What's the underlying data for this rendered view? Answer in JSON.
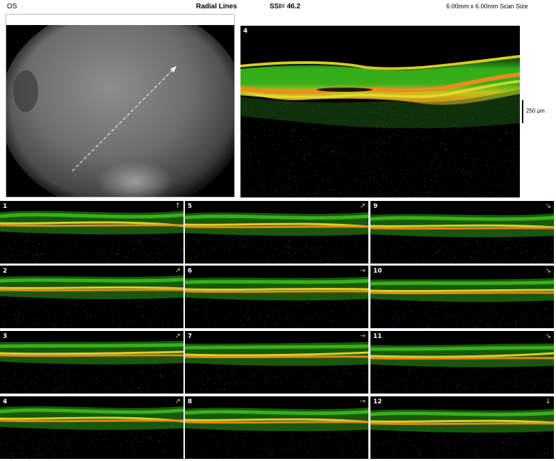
{
  "header": {
    "eye": "OS",
    "scan_pattern": "Radial Lines",
    "ssi": "SSI= 46.2",
    "scan_size": "6.00mm x 6.00mm Scan Size"
  },
  "fundus": {
    "scan_line_icon": "arrow-icon"
  },
  "main_scan": {
    "number": "4",
    "scale_label": "250 µm"
  },
  "thumbnails": [
    {
      "number": "1",
      "arrow": "↑"
    },
    {
      "number": "5",
      "arrow": "↗"
    },
    {
      "number": "9",
      "arrow": "↘"
    },
    {
      "number": "2",
      "arrow": "↗"
    },
    {
      "number": "6",
      "arrow": "→"
    },
    {
      "number": "10",
      "arrow": "↘"
    },
    {
      "number": "3",
      "arrow": "↗"
    },
    {
      "number": "7",
      "arrow": "→"
    },
    {
      "number": "11",
      "arrow": "↘"
    },
    {
      "number": "4",
      "arrow": "↗"
    },
    {
      "number": "8",
      "arrow": "→"
    },
    {
      "number": "12",
      "arrow": "↓"
    }
  ],
  "colors": {
    "scan_background": "#000000",
    "retina_green": "#39c21a",
    "retina_yellow": "#e9e22a",
    "rpe_orange": "#f08a1e",
    "noise_blue": "#3d6fd0"
  }
}
